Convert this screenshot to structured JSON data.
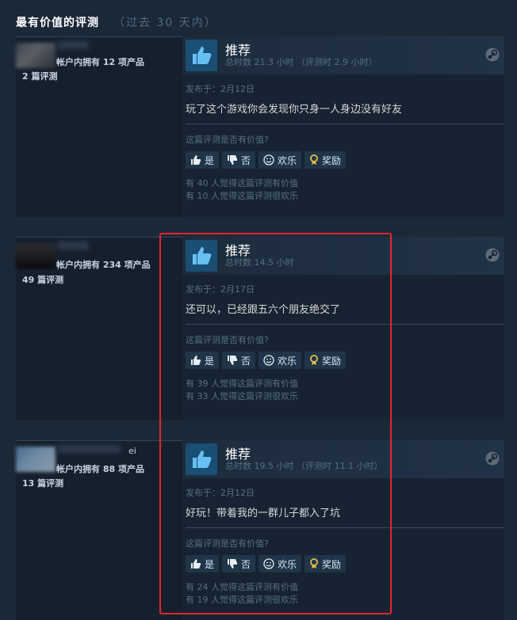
{
  "header": {
    "title": "最有价值的评测",
    "subtitle": "（过去 30 天内）"
  },
  "common": {
    "helpful_question": "这篇评测是否有价值?",
    "btn_yes": "是",
    "btn_no": "否",
    "btn_funny": "欢乐",
    "btn_award": "奖励"
  },
  "reviews": [
    {
      "user_products": "帐户内拥有 12 项产品",
      "user_reviews": "2 篇评测",
      "recommend": "推荐",
      "hours": "总时数 21.3 小时 （评测时 2.9 小时）",
      "posted": "发布于：2月12日",
      "content": "玩了这个游戏你会发现你只身一人身边没有好友",
      "helpful": "有 40 人觉得这篇评测有价值",
      "funny": "有 10 人觉得这篇评测很欢乐"
    },
    {
      "user_products": "帐户内拥有 234 项产品",
      "user_reviews": "49 篇评测",
      "recommend": "推荐",
      "hours": "总时数 14.5 小时",
      "posted": "发布于：2月17日",
      "content": "还可以，已经跟五六个朋友绝交了",
      "helpful": "有 39 人觉得这篇评测有价值",
      "funny": "有 33 人觉得这篇评测很欢乐"
    },
    {
      "user_name_fragment": "ei",
      "user_products": "帐户内拥有 88 项产品",
      "user_reviews": "13 篇评测",
      "recommend": "推荐",
      "hours": "总时数 19.5 小时 （评测时 11.1 小时）",
      "posted": "发布于：2月12日",
      "content": "好玩！带着我的一群儿子都入了坑",
      "helpful": "有 24 人觉得这篇评测有价值",
      "funny": "有 19 人觉得这篇评测很欢乐"
    }
  ],
  "colors": {
    "highlight": "#e0262d",
    "accent": "#66c0f4",
    "background": "#1b2838"
  }
}
